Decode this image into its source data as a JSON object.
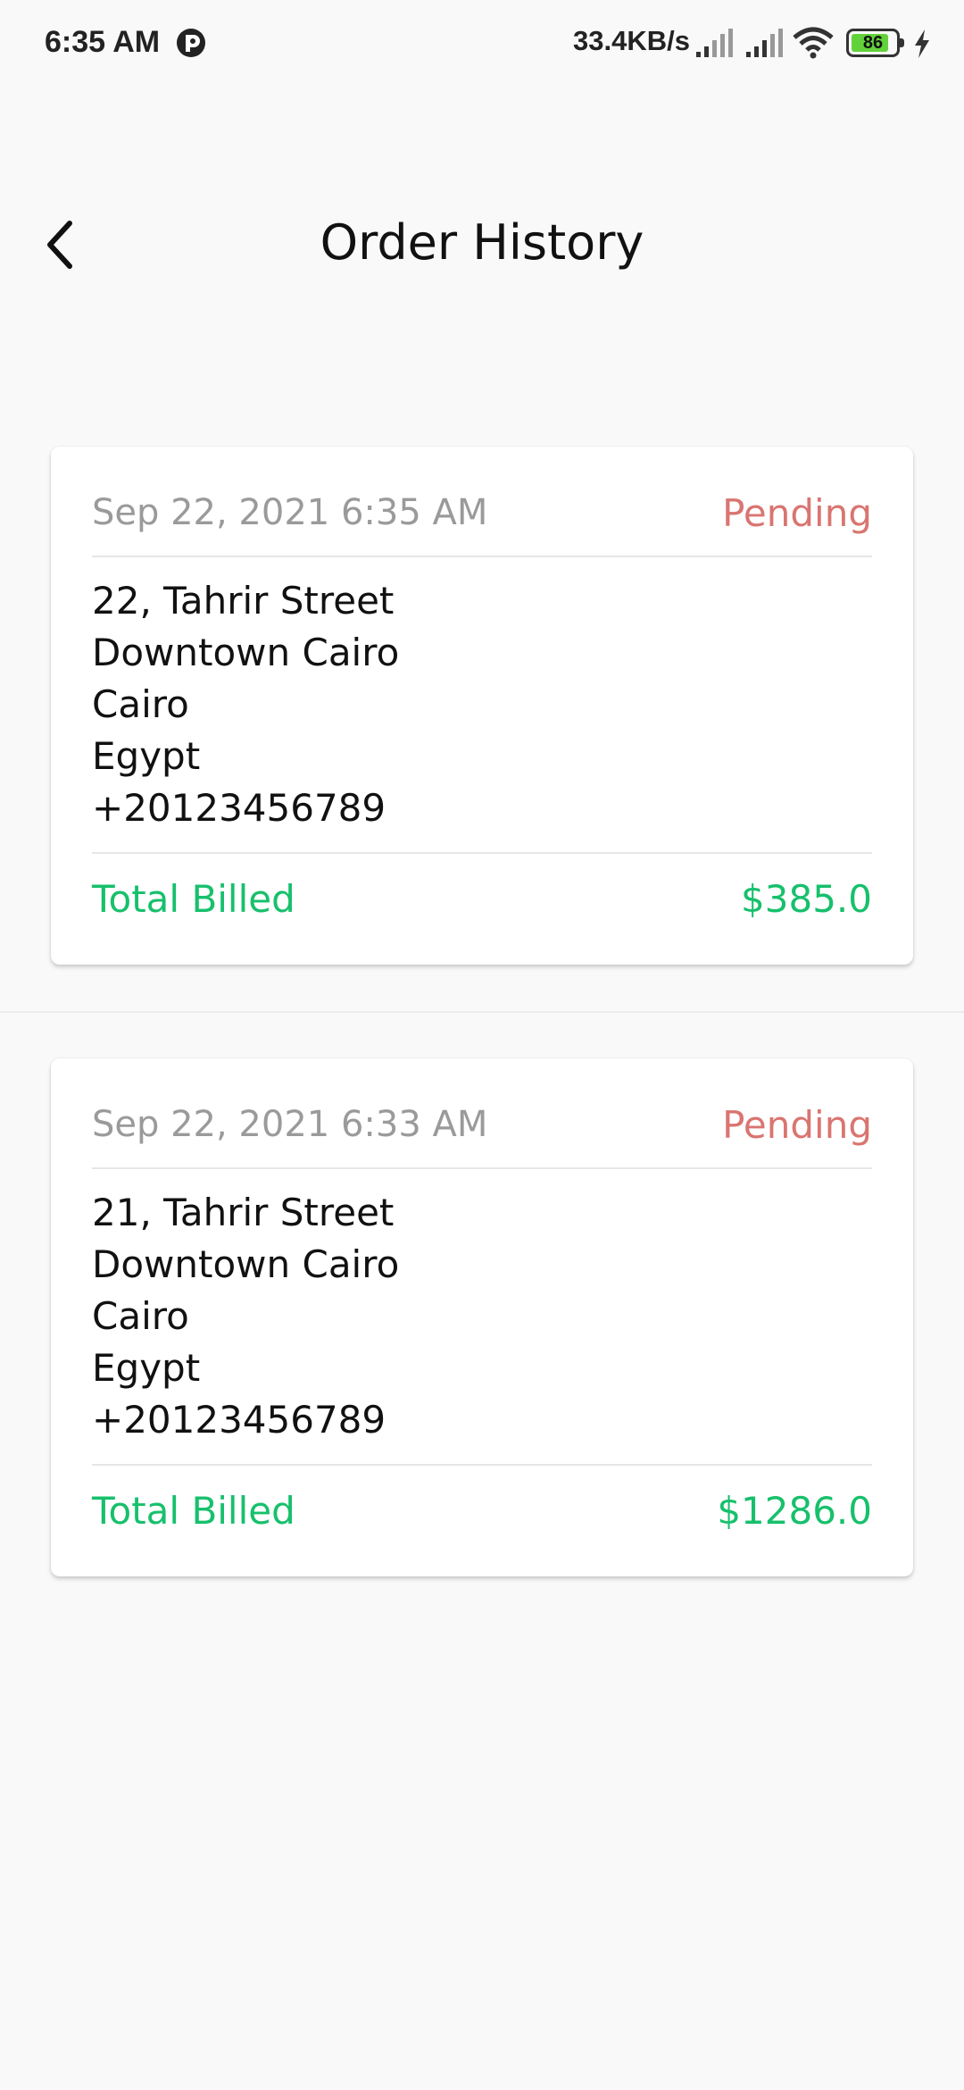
{
  "status_bar": {
    "time": "6:35 AM",
    "net_speed": "33.4KB/s",
    "battery_level": "86",
    "battery_fraction": 0.86,
    "icons": [
      "app-notification-icon",
      "signal-icon",
      "signal-icon",
      "wifi-icon",
      "battery-icon",
      "charging-icon"
    ]
  },
  "header": {
    "title": "Order History",
    "back_icon": "chevron-left-icon"
  },
  "colors": {
    "background": "#f9f9f9",
    "status_pending": "#d97571",
    "total_green": "#17c06c",
    "date_grey": "#9a9a9a"
  },
  "orders": [
    {
      "date": "Sep 22, 2021 6:35 AM",
      "status": "Pending",
      "address": [
        "22, Tahrir Street",
        "Downtown Cairo",
        "Cairo",
        "Egypt",
        "+20123456789"
      ],
      "total_label": "Total Billed",
      "total": "$385.0"
    },
    {
      "date": "Sep 22, 2021 6:33 AM",
      "status": "Pending",
      "address": [
        "21, Tahrir Street",
        "Downtown Cairo",
        "Cairo",
        "Egypt",
        "+20123456789"
      ],
      "total_label": "Total Billed",
      "total": "$1286.0"
    }
  ]
}
